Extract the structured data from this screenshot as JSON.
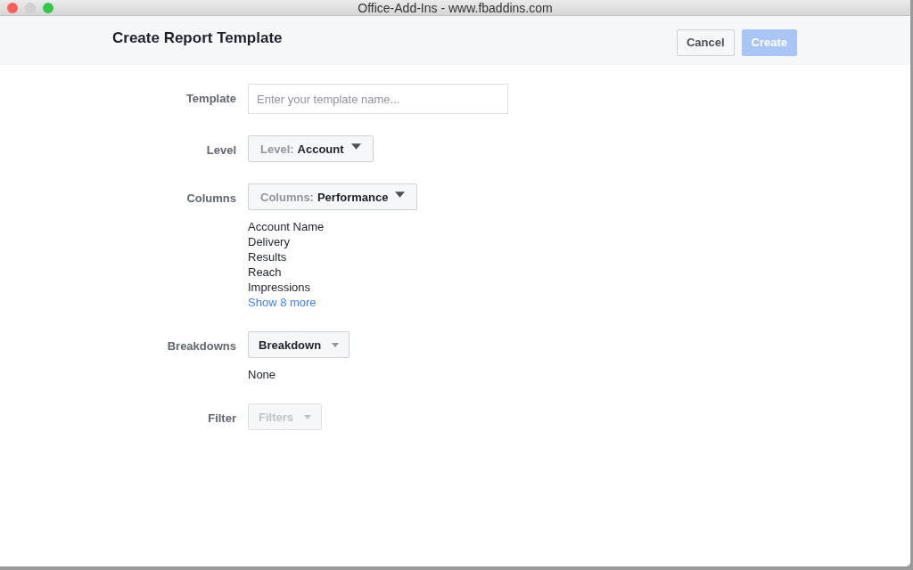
{
  "window": {
    "title": "Office-Add-Ins - www.fbaddins.com"
  },
  "header": {
    "title": "Create Report Template",
    "buttons": [
      {
        "label": "Cancel",
        "kind": "secondary",
        "disabled": false
      },
      {
        "label": "Create",
        "kind": "primary",
        "disabled": true
      }
    ]
  },
  "form": [
    {
      "kind": "input",
      "label": "Template",
      "placeholder": "Enter your template name..."
    },
    {
      "kind": "dropdown",
      "label": "Level",
      "prefix": "Level:",
      "value": "Account",
      "disabled": false
    },
    {
      "kind": "dropdown",
      "label": "Columns",
      "prefix": "Columns:",
      "value": "Performance",
      "disabled": false,
      "items": [
        "Account Name",
        "Delivery",
        "Results",
        "Reach",
        "Impressions"
      ],
      "link": "Show 8 more"
    },
    {
      "kind": "dropdown",
      "label": "Breakdowns",
      "value": "Breakdown",
      "disabled": false,
      "items": [
        "None"
      ]
    },
    {
      "kind": "dropdown",
      "label": "Filter",
      "value": "Filters",
      "disabled": true
    }
  ]
}
